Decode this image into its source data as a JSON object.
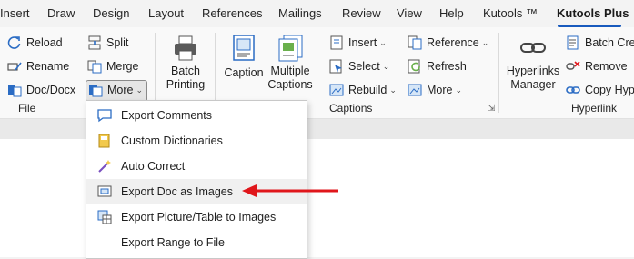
{
  "tabs": [
    {
      "label": "Insert"
    },
    {
      "label": "Draw"
    },
    {
      "label": "Design"
    },
    {
      "label": "Layout"
    },
    {
      "label": "References"
    },
    {
      "label": "Mailings"
    },
    {
      "label": "Review"
    },
    {
      "label": "View"
    },
    {
      "label": "Help"
    },
    {
      "label": "Kutools ™"
    },
    {
      "label": "Kutools Plus",
      "active": true
    }
  ],
  "ribbon": {
    "file_group": {
      "label": "File",
      "reload": "Reload",
      "rename": "Rename",
      "doc_docx": "Doc/Docx",
      "split": "Split",
      "merge": "Merge",
      "more": "More"
    },
    "batch_printing": [
      "Batch",
      "Printing"
    ],
    "captions_group": {
      "label": "Captions",
      "caption": "Caption",
      "multiple": [
        "Multiple",
        "Captions"
      ],
      "insert": "Insert",
      "select": "Select",
      "rebuild": "Rebuild",
      "reference": "Reference",
      "refresh": "Refresh",
      "more": "More"
    },
    "hyperlink_group": {
      "label": "Hyperlink",
      "manager": [
        "Hyperlinks",
        "Manager"
      ],
      "batch_create": "Batch Crea",
      "remove": "Remove",
      "copy_hype": "Copy Hype"
    }
  },
  "dropdown_menu": {
    "items": [
      {
        "label": "Export Comments",
        "icon": "export-comments-icon"
      },
      {
        "label": "Custom Dictionaries",
        "icon": "dictionary-icon"
      },
      {
        "label": "Auto Correct",
        "icon": "auto-correct-icon"
      },
      {
        "label": "Export Doc as Images",
        "icon": "export-images-icon",
        "highlighted": true
      },
      {
        "label": "Export Picture/Table to Images",
        "icon": "picture-table-icon"
      },
      {
        "label": "Export Range to File",
        "icon": ""
      }
    ]
  },
  "colors": {
    "accent": "#185abd",
    "arrow": "#e0161b",
    "hover": "#f0f0f0"
  }
}
